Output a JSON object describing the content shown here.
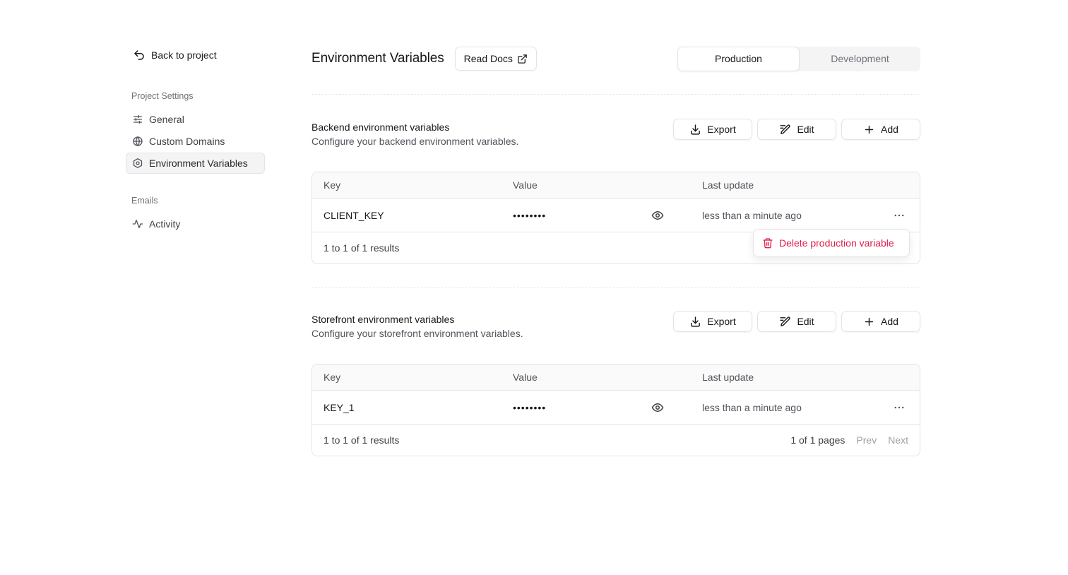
{
  "sidebar": {
    "back_label": "Back to project",
    "project_settings_label": "Project Settings",
    "project_items": [
      {
        "label": "General",
        "icon": "sliders-icon"
      },
      {
        "label": "Custom Domains",
        "icon": "globe-icon"
      },
      {
        "label": "Environment Variables",
        "icon": "gear-icon",
        "active": true
      }
    ],
    "emails_label": "Emails",
    "email_items": [
      {
        "label": "Activity",
        "icon": "activity-icon"
      }
    ]
  },
  "header": {
    "title": "Environment Variables",
    "docs_label": "Read Docs",
    "env_tabs": [
      {
        "label": "Production",
        "active": true
      },
      {
        "label": "Development",
        "active": false
      }
    ]
  },
  "actions": {
    "export_label": "Export",
    "edit_label": "Edit",
    "add_label": "Add"
  },
  "columns": {
    "key": "Key",
    "value": "Value",
    "last_update": "Last update"
  },
  "backend": {
    "title": "Backend environment variables",
    "description": "Configure your backend environment variables.",
    "rows": [
      {
        "key": "CLIENT_KEY",
        "value": "••••••••",
        "last_update": "less than a minute ago"
      }
    ],
    "results": "1 to 1 of 1 results"
  },
  "storefront": {
    "title": "Storefront environment variables",
    "description": "Configure your storefront environment variables.",
    "rows": [
      {
        "key": "KEY_1",
        "value": "••••••••",
        "last_update": "less than a minute ago"
      }
    ],
    "results": "1 to 1 of 1 results",
    "pages": "1 of 1 pages",
    "prev_label": "Prev",
    "next_label": "Next"
  },
  "popover": {
    "delete_label": "Delete production variable",
    "color": "#e11d48"
  }
}
